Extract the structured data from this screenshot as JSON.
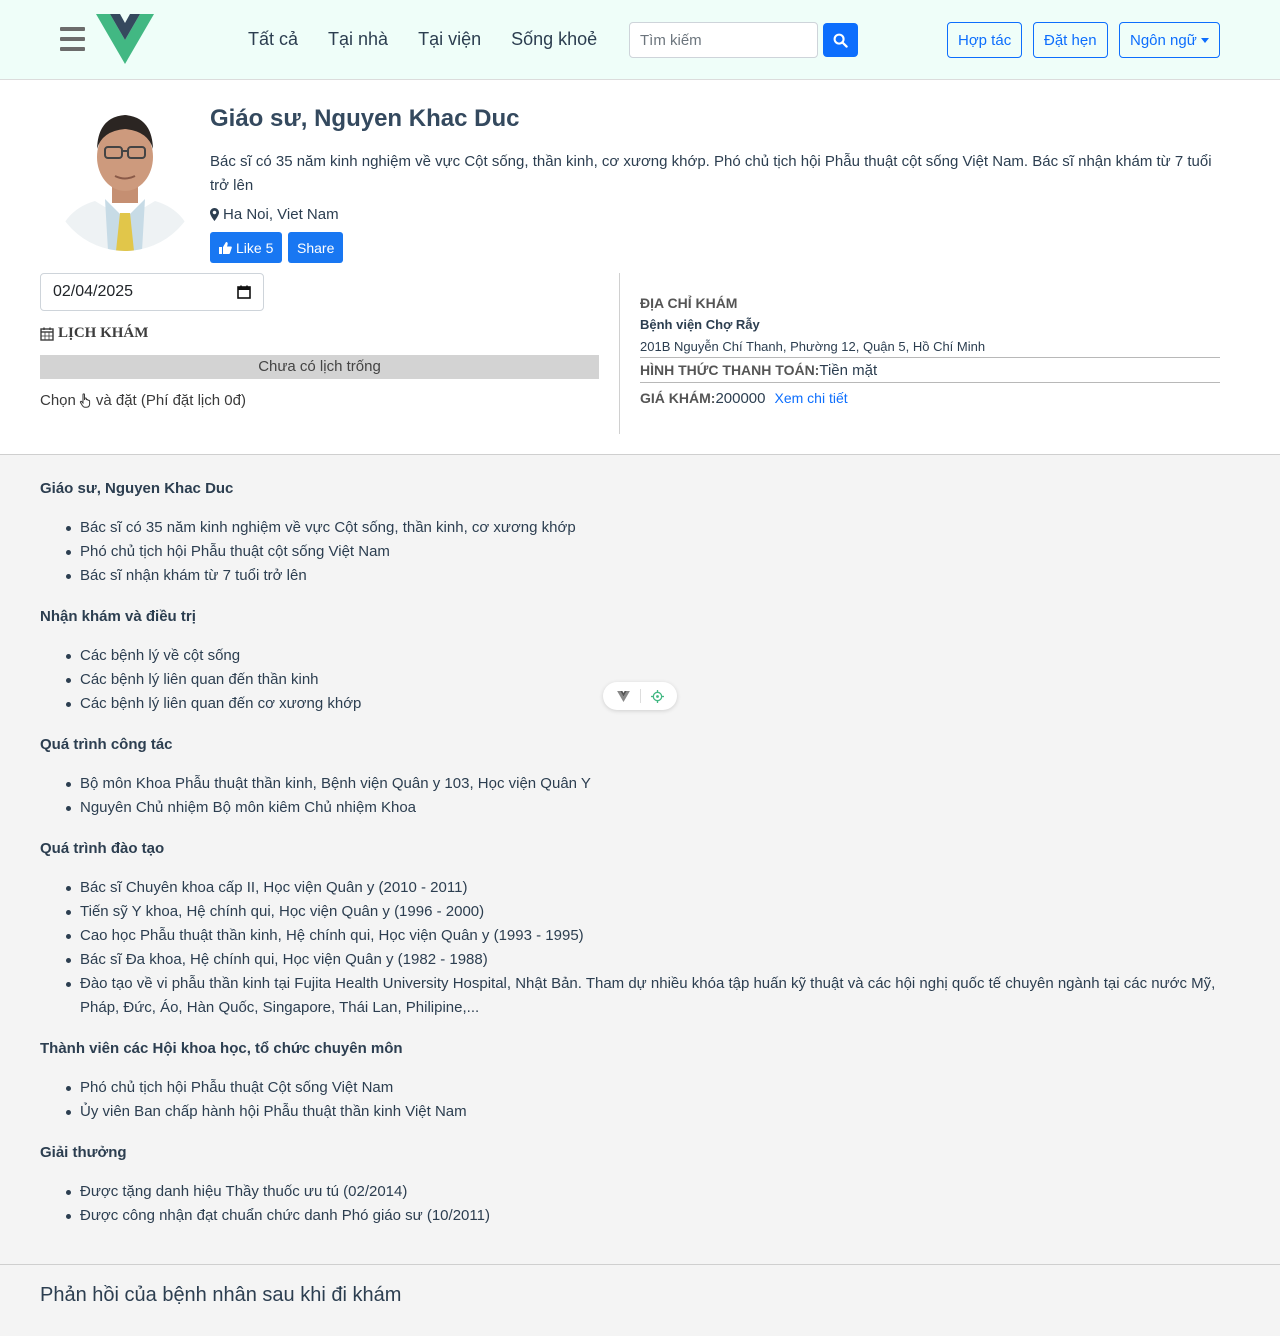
{
  "header": {
    "nav": [
      "Tất cả",
      "Tại nhà",
      "Tại viện",
      "Sống khoẻ"
    ],
    "search_placeholder": "Tìm kiếm",
    "buttons": {
      "partner": "Hợp tác",
      "booking": "Đặt hẹn",
      "language": "Ngôn ngữ"
    },
    "brand_color": "#42b883",
    "accent_color": "#0d6efd"
  },
  "doctor": {
    "name": "Giáo sư, Nguyen Khac Duc",
    "description": "Bác sĩ có 35 năm kinh nghiệm về vực Cột sống, thần kinh, cơ xương khớp. Phó chủ tịch hội Phẫu thuật cột sống Việt Nam. Bác sĩ nhận khám từ 7 tuổi trở lên",
    "location": "Ha Noi, Viet Nam",
    "like_label": "Like 5",
    "share_label": "Share"
  },
  "schedule": {
    "date": "02/04/2025",
    "title": "LỊCH KHÁM",
    "empty": "Chưa có lịch trống",
    "choose_prefix": "Chọn",
    "choose_suffix": "và đặt (Phí đặt lịch 0đ)"
  },
  "clinic": {
    "address_title": "ĐỊA CHỈ KHÁM",
    "name": "Bệnh viện Chợ Rẫy",
    "address": "201B Nguyễn Chí Thanh, Phường 12, Quận 5, Hồ Chí Minh",
    "payment_label": "HÌNH THỨC THANH TOÁN:",
    "payment_value": "Tiền mặt",
    "price_label": "GIÁ KHÁM:",
    "price_value": "200000",
    "detail_link": "Xem chi tiết"
  },
  "sections": [
    {
      "title": "Giáo sư, Nguyen Khac Duc",
      "items": [
        "Bác sĩ có 35 năm kinh nghiệm về vực Cột sống, thần kinh, cơ xương khớp",
        "Phó chủ tịch hội Phẫu thuật cột sống Việt Nam",
        "Bác sĩ nhận khám từ 7 tuổi trở lên"
      ]
    },
    {
      "title": "Nhận khám và điều trị",
      "items": [
        "Các bệnh lý về cột sống",
        "Các bệnh lý liên quan đến thần kinh",
        "Các bệnh lý liên quan đến cơ xương khớp"
      ]
    },
    {
      "title": "Quá trình công tác",
      "items": [
        "Bộ môn Khoa Phẫu thuật thần kinh, Bệnh viện Quân y 103, Học viện Quân Y",
        "Nguyên Chủ nhiệm Bộ môn kiêm Chủ nhiệm Khoa"
      ]
    },
    {
      "title": "Quá trình đào tạo",
      "items": [
        "Bác sĩ Chuyên khoa cấp II, Học viện Quân y (2010 - 2011)",
        "Tiến sỹ Y khoa, Hệ chính qui, Học viện Quân y (1996 - 2000)",
        "Cao học Phẫu thuật thần kinh, Hệ chính qui, Học viện Quân y (1993 - 1995)",
        "Bác sĩ Đa khoa, Hệ chính qui, Học viện Quân y (1982 - 1988)",
        "Đào tạo về vi phẫu thần kinh tại Fujita Health University Hospital, Nhật Bản. Tham dự nhiều khóa tập huấn kỹ thuật và các hội nghị quốc tế chuyên ngành tại các nước Mỹ, Pháp, Đức, Áo, Hàn Quốc, Singapore, Thái Lan, Philipine,..."
      ]
    },
    {
      "title": "Thành viên các Hội khoa học, tổ chức chuyên môn",
      "items": [
        "Phó chủ tịch hội Phẫu thuật Cột sống Việt Nam",
        "Ủy viên Ban chấp hành hội Phẫu thuật thần kinh Việt Nam"
      ]
    },
    {
      "title": "Giải thưởng",
      "items": [
        "Được tặng danh hiệu Thầy thuốc ưu tú (02/2014)",
        "Được công nhận đạt chuẩn chức danh Phó giáo sư (10/2011)"
      ]
    }
  ],
  "feedback": {
    "title": "Phản hồi của bệnh nhân sau khi đi khám"
  }
}
